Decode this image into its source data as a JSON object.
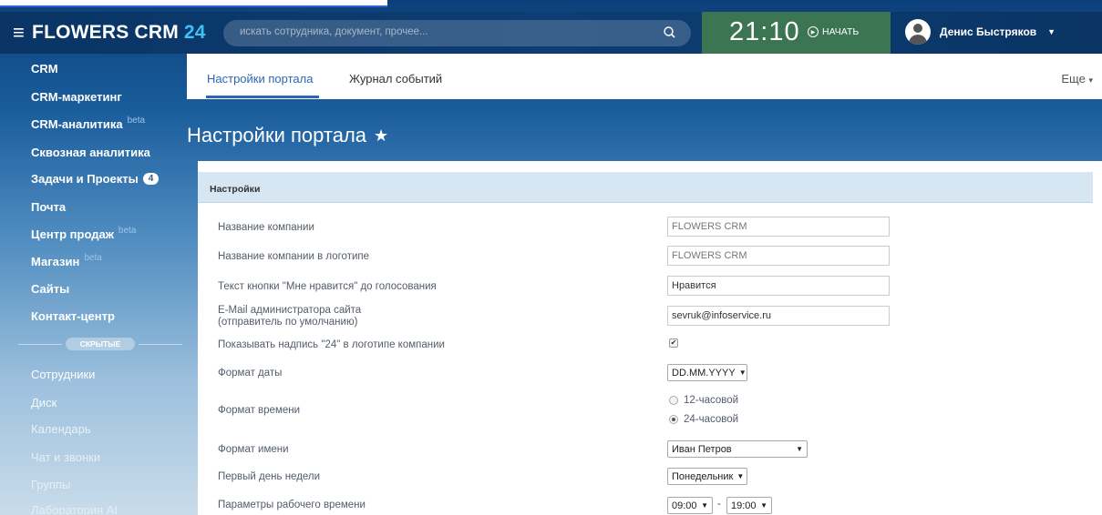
{
  "app": {
    "brand_main": "FLOWERS CRM",
    "brand_num": "24",
    "search_placeholder": "искать сотрудника, документ, прочее...",
    "clock": "21:10",
    "start_label": "НАЧАТЬ",
    "user_name": "Денис Быстряков"
  },
  "sidebar": {
    "items": [
      {
        "label": "CRM"
      },
      {
        "label": "CRM-маркетинг"
      },
      {
        "label": "CRM-аналитика",
        "sup": "beta"
      },
      {
        "label": "Сквозная аналитика"
      },
      {
        "label": "Задачи и Проекты",
        "badge": "4"
      },
      {
        "label": "Почта"
      },
      {
        "label": "Центр продаж",
        "sup": "beta"
      },
      {
        "label": "Магазин",
        "sup": "beta"
      },
      {
        "label": "Сайты"
      },
      {
        "label": "Контакт-центр"
      }
    ],
    "hidden_label": "СКРЫТЫЕ",
    "hidden_items": [
      {
        "label": "Сотрудники"
      },
      {
        "label": "Диск"
      },
      {
        "label": "Календарь"
      },
      {
        "label": "Чат и звонки"
      },
      {
        "label": "Группы"
      },
      {
        "label": "Лаборатория AI"
      }
    ]
  },
  "tabs": {
    "items": [
      {
        "label": "Настройки портала"
      },
      {
        "label": "Журнал событий"
      }
    ],
    "more_label": "Еще"
  },
  "page": {
    "title": "Настройки портала",
    "section_header": "Настройки"
  },
  "settings": {
    "company_name_label": "Название компании",
    "company_name_value": "FLOWERS CRM",
    "logo_name_label": "Название компании в логотипе",
    "logo_name_value": "FLOWERS CRM",
    "like_button_label": "Текст кнопки \"Мне нравится\" до голосования",
    "like_button_value": "Нравится",
    "admin_email_label_1": "E-Mail администратора сайта",
    "admin_email_label_2": "(отправитель по умолчанию)",
    "admin_email_value": "sevruk@infoservice.ru",
    "show_24_label": "Показывать надпись \"24\" в логотипе компании",
    "show_24_checked": true,
    "date_format_label": "Формат даты",
    "date_format_value": "DD.MM.YYYY",
    "time_format_label": "Формат времени",
    "time_format_options": [
      "12-часовой",
      "24-часовой"
    ],
    "time_format_selected": "24-часовой",
    "name_format_label": "Формат имени",
    "name_format_value": "Иван Петров",
    "first_day_label": "Первый день недели",
    "first_day_value": "Понедельник",
    "work_time_label": "Параметры рабочего времени",
    "work_time_from": "09:00",
    "work_time_to": "19:00"
  },
  "colors": {
    "accent": "#2a66b4",
    "topbar": "#0d3d72",
    "clock_bg": "#3b7552",
    "brand_num": "#3fc1f2"
  }
}
